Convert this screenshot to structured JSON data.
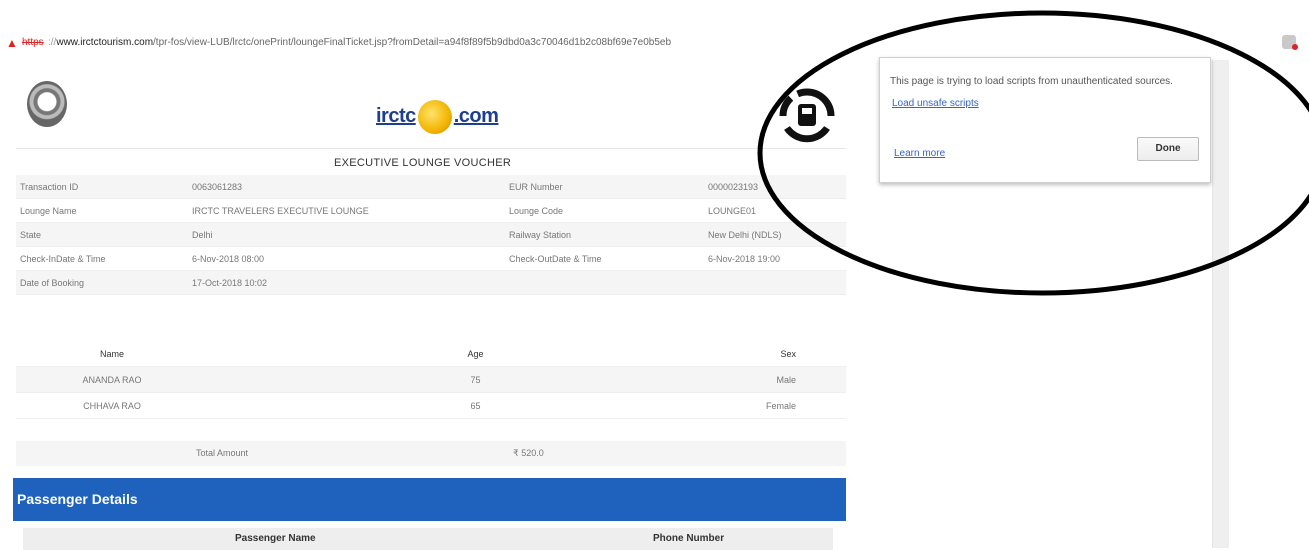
{
  "address_bar": {
    "warning_icon": "warning-triangle-icon",
    "protocol": "https",
    "host": "www.irctctourism.com",
    "path": "/tpr-fos/view-LUB/lrctc/onePrint/loungeFinalTicket.jsp?fromDetail=a94f8f89f5b9dbd0a3c70046d1b2c08bf69e7e0b5eb"
  },
  "voucher": {
    "brand_text_left": "irctc",
    "brand_text_right": ".com",
    "title": "EXECUTIVE LOUNGE VOUCHER",
    "rows": [
      {
        "label1": "Transaction ID",
        "value1": "0063061283",
        "label2": "EUR Number",
        "value2": "0000023193"
      },
      {
        "label1": "Lounge Name",
        "value1": "IRCTC TRAVELERS EXECUTIVE LOUNGE",
        "label2": "Lounge Code",
        "value2": "LOUNGE01"
      },
      {
        "label1": "State",
        "value1": "Delhi",
        "label2": "Railway Station",
        "value2": "New Delhi (NDLS)"
      },
      {
        "label1": "Check-InDate & Time",
        "value1": "6-Nov-2018 08:00",
        "label2": "Check-OutDate & Time",
        "value2": "6-Nov-2018 19:00"
      },
      {
        "label1": "Date of Booking",
        "value1": "17-Oct-2018 10:02",
        "label2": "",
        "value2": ""
      }
    ],
    "passenger_header": {
      "name": "Name",
      "age": "Age",
      "sex": "Sex"
    },
    "passengers": [
      {
        "name": "ANANDA RAO",
        "age": "75",
        "sex": "Male"
      },
      {
        "name": "CHHAVA RAO",
        "age": "65",
        "sex": "Female"
      }
    ],
    "total_label": "Total Amount",
    "total_value": "₹ 520.0"
  },
  "passenger_details": {
    "title": "Passenger Details",
    "col_name": "Passenger Name",
    "col_phone": "Phone Number"
  },
  "popup": {
    "message": "This page is trying to load scripts from unauthenticated sources.",
    "load_link": "Load unsafe scripts",
    "learn_link": "Learn more",
    "done_button": "Done"
  },
  "colors": {
    "banner_blue": "#1e62bd",
    "link_blue": "#3366cc",
    "warning_red": "#d22222",
    "annotation": "#000000"
  }
}
